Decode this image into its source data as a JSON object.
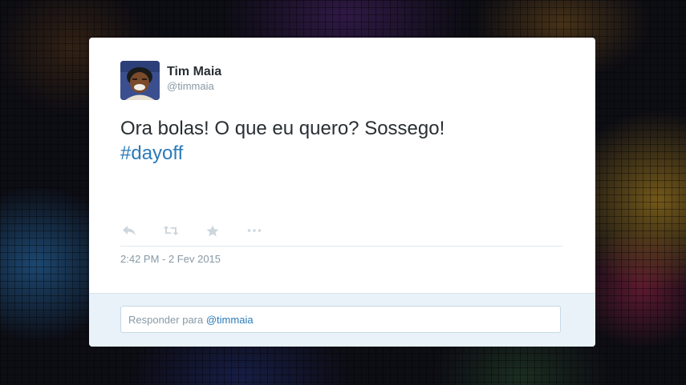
{
  "tweet": {
    "display_name": "Tim Maia",
    "handle": "@timmaia",
    "text": "Ora bolas! O que eu quero? Sossego!",
    "hashtag": "#dayoff",
    "timestamp": "2:42 PM - 2 Fev 2015"
  },
  "actions": [
    {
      "icon": "reply-icon"
    },
    {
      "icon": "retweet-icon"
    },
    {
      "icon": "favorite-star-icon"
    },
    {
      "icon": "more-options-icon"
    }
  ],
  "reply": {
    "prefix": "Responder para",
    "handle": "@timmaia"
  },
  "colors": {
    "text": "#292f33",
    "muted": "#8899a6",
    "link": "#2b7bb9",
    "reply_bg": "#e9f2f9",
    "icon": "#ccd6dd"
  }
}
